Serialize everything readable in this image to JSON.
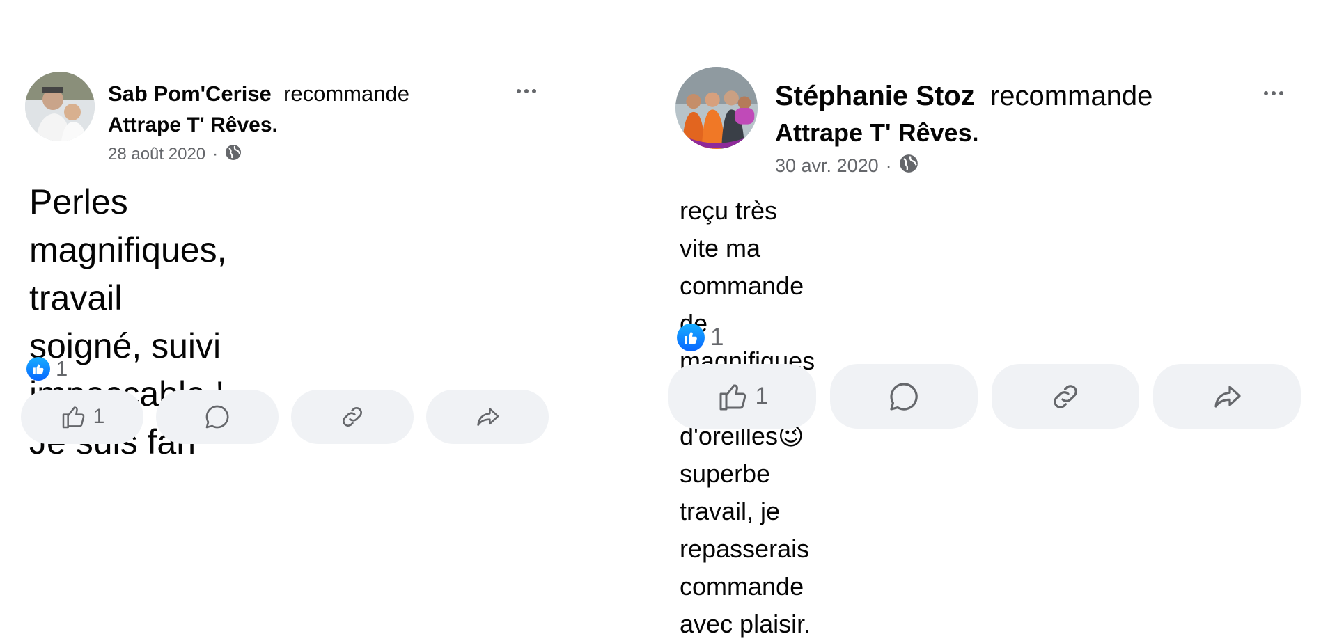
{
  "reviews": [
    {
      "author": "Sab Pom'Cerise",
      "verb": "recommande",
      "page": "Attrape T' Rêves.",
      "date": "28 août 2020",
      "separator": "·",
      "privacy_icon": "globe-icon",
      "more_icon": "more-options-icon",
      "text": "Perles magnifiques,  travail\nsoigné,  suivi impeccable !\nJe suis fan",
      "reaction_icon": "like-reaction-icon",
      "reaction_count": "1",
      "actions": {
        "like_icon": "thumbs-up-icon",
        "like_count": "1",
        "comment_icon": "comment-icon",
        "link_icon": "link-icon",
        "share_icon": "share-icon"
      }
    },
    {
      "author": "Stéphanie Stoz",
      "verb": "recommande",
      "page": "Attrape T' Rêves.",
      "date": "30 avr. 2020",
      "separator": "·",
      "privacy_icon": "globe-icon",
      "more_icon": "more-options-icon",
      "text_before_emoji": "reçu très vite ma commande de magnifiques\nboucles d'oreilles",
      "emoji": "😉",
      "text_after_emoji": " superbe travail, je\nrepasserais commande avec plaisir.",
      "reaction_icon": "like-reaction-icon",
      "reaction_count": "1",
      "actions": {
        "like_icon": "thumbs-up-icon",
        "like_count": "1",
        "comment_icon": "comment-icon",
        "link_icon": "link-icon",
        "share_icon": "share-icon"
      }
    }
  ],
  "colors": {
    "text": "#050505",
    "secondary": "#65676b",
    "pill_bg": "#f0f2f5",
    "like_blue": "#0866ff"
  }
}
